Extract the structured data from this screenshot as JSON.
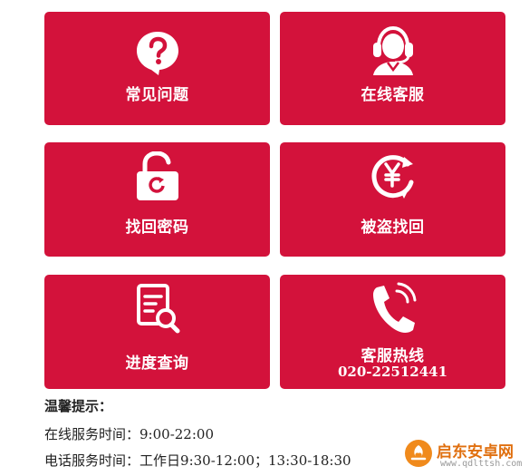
{
  "tiles": [
    {
      "label": "常见问题",
      "icon": "question-bubble-icon"
    },
    {
      "label": "在线客服",
      "icon": "headset-agent-icon"
    },
    {
      "label": "找回密码",
      "icon": "padlock-refresh-icon"
    },
    {
      "label": "被盗找回",
      "icon": "yuan-recover-icon"
    },
    {
      "label": "进度查询",
      "icon": "document-search-icon"
    },
    {
      "label": "客服热线",
      "sub": "020-22512441",
      "icon": "phone-ringing-icon"
    }
  ],
  "notice": {
    "title": "温馨提示：",
    "online_label": "在线服务时间：",
    "online_value": "9:00-22:00",
    "phone_label": "电话服务时间：",
    "phone_workday": "工作日",
    "phone_value": "9:30-12:00；13:30-18:30"
  },
  "watermark": {
    "title": "启东安卓网",
    "url": "www.qdlttsh.com"
  },
  "colors": {
    "tile_bg": "#d3123b",
    "text": "#222222",
    "watermark": "#e07010"
  }
}
